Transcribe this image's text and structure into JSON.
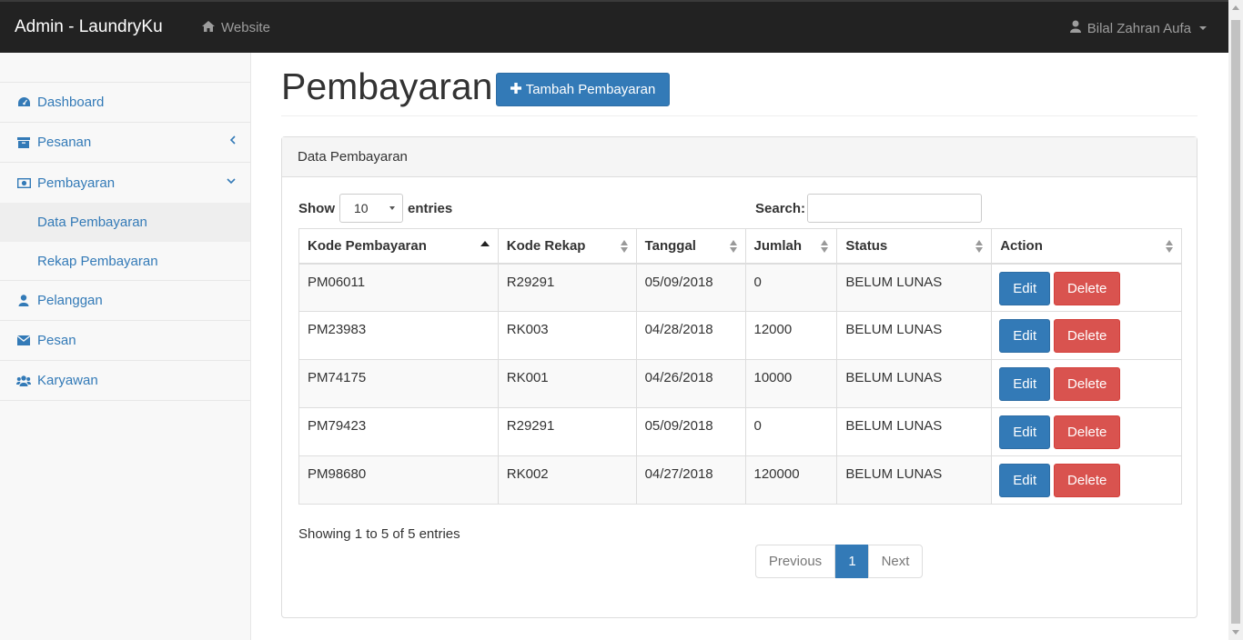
{
  "navbar": {
    "brand": "Admin - LaundryKu",
    "website_label": "Website",
    "user_label": "Bilal Zahran Aufa"
  },
  "sidebar": {
    "items": [
      {
        "label": "Dashboard",
        "icon": "dashboard-icon"
      },
      {
        "label": "Pesanan",
        "icon": "archive-icon"
      },
      {
        "label": "Pembayaran",
        "icon": "money-icon"
      },
      {
        "label": "Pelanggan",
        "icon": "user-icon"
      },
      {
        "label": "Pesan",
        "icon": "envelope-icon"
      },
      {
        "label": "Karyawan",
        "icon": "users-icon"
      }
    ],
    "subitems": [
      {
        "label": "Data Pembayaran"
      },
      {
        "label": "Rekap Pembayaran"
      }
    ]
  },
  "header": {
    "title": "Pembayaran",
    "add_button": "Tambah Pembayaran"
  },
  "panel": {
    "heading": "Data Pembayaran",
    "show_label": "Show",
    "entries_label": "entries",
    "page_size": "10",
    "search_label": "Search:",
    "search_value": ""
  },
  "table": {
    "columns": [
      "Kode Pembayaran",
      "Kode Rekap",
      "Tanggal",
      "Jumlah",
      "Status",
      "Action"
    ],
    "rows": [
      {
        "kode": "PM06011",
        "rekap": "R29291",
        "tanggal": "05/09/2018",
        "jumlah": "0",
        "status": "BELUM LUNAS"
      },
      {
        "kode": "PM23983",
        "rekap": "RK003",
        "tanggal": "04/28/2018",
        "jumlah": "12000",
        "status": "BELUM LUNAS"
      },
      {
        "kode": "PM74175",
        "rekap": "RK001",
        "tanggal": "04/26/2018",
        "jumlah": "10000",
        "status": "BELUM LUNAS"
      },
      {
        "kode": "PM79423",
        "rekap": "R29291",
        "tanggal": "05/09/2018",
        "jumlah": "0",
        "status": "BELUM LUNAS"
      },
      {
        "kode": "PM98680",
        "rekap": "RK002",
        "tanggal": "04/27/2018",
        "jumlah": "120000",
        "status": "BELUM LUNAS"
      }
    ],
    "edit_label": "Edit",
    "delete_label": "Delete"
  },
  "footer": {
    "info": "Showing 1 to 5 of 5 entries",
    "prev_label": "Previous",
    "current_page": "1",
    "next_label": "Next"
  }
}
